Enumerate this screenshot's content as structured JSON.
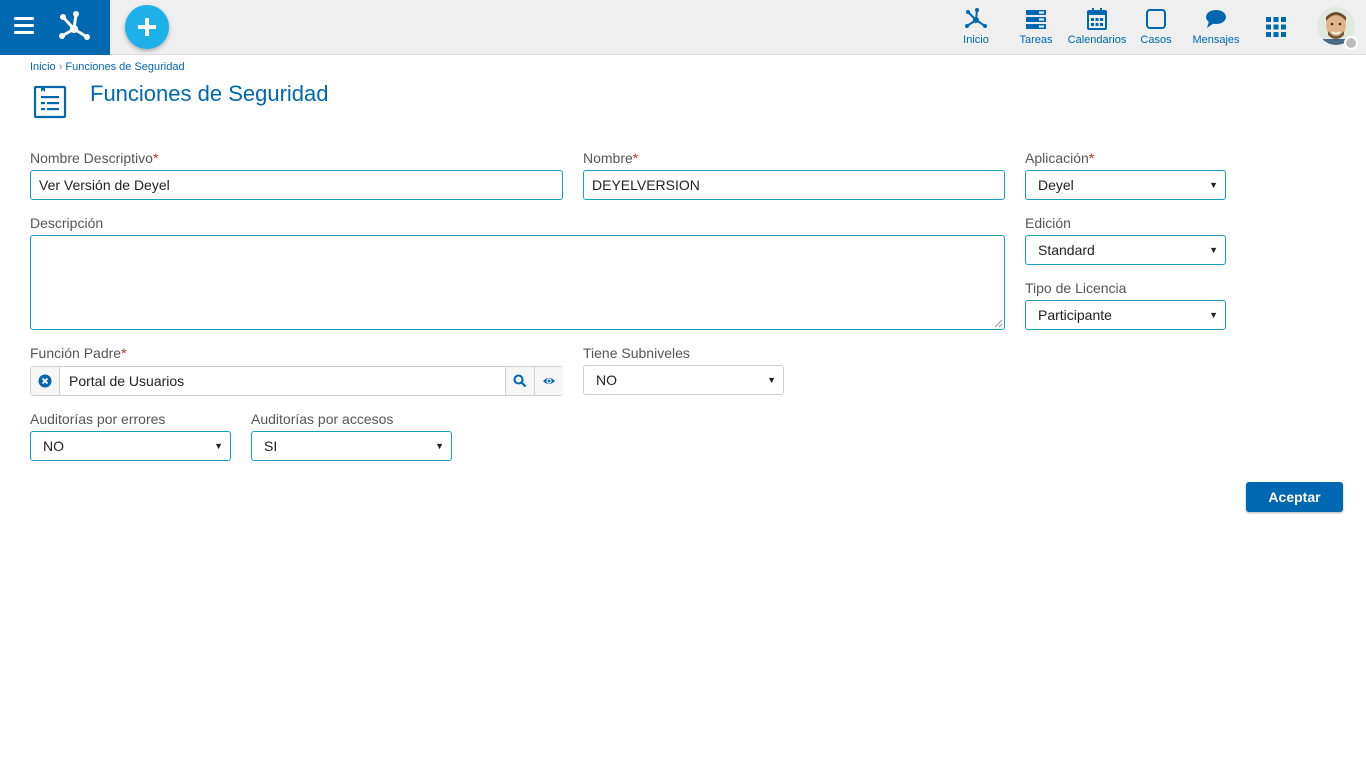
{
  "header": {
    "nav": [
      {
        "key": "inicio",
        "label": "Inicio",
        "icon": "network-icon"
      },
      {
        "key": "tareas",
        "label": "Tareas",
        "icon": "tasks-icon"
      },
      {
        "key": "calendarios",
        "label": "Calendarios",
        "icon": "calendar-icon"
      },
      {
        "key": "casos",
        "label": "Casos",
        "icon": "square-icon"
      },
      {
        "key": "mensajes",
        "label": "Mensajes",
        "icon": "chat-bubble-icon"
      }
    ],
    "brand_color": "#0067b1",
    "add_button_color": "#1eb0e8"
  },
  "breadcrumb": {
    "home": "Inicio",
    "separator": "›",
    "current": "Funciones de Seguridad"
  },
  "page": {
    "title": "Funciones de Seguridad"
  },
  "form": {
    "nombre_descriptivo": {
      "label": "Nombre Descriptivo",
      "required": "*",
      "value": "Ver Versión de Deyel"
    },
    "nombre": {
      "label": "Nombre",
      "required": "*",
      "value": "DEYELVERSION"
    },
    "aplicacion": {
      "label": "Aplicación",
      "required": "*",
      "value": "Deyel"
    },
    "descripcion": {
      "label": "Descripción",
      "value": ""
    },
    "edicion": {
      "label": "Edición",
      "value": "Standard"
    },
    "tipo_licencia": {
      "label": "Tipo de Licencia",
      "value": "Participante"
    },
    "funcion_padre": {
      "label": "Función Padre",
      "required": "*",
      "value": "Portal de Usuarios"
    },
    "tiene_subniveles": {
      "label": "Tiene Subniveles",
      "value": "NO"
    },
    "auditorias_errores": {
      "label": "Auditorías por errores",
      "value": "NO"
    },
    "auditorias_accesos": {
      "label": "Auditorías por accesos",
      "value": "SI"
    }
  },
  "actions": {
    "accept_label": "Aceptar"
  }
}
